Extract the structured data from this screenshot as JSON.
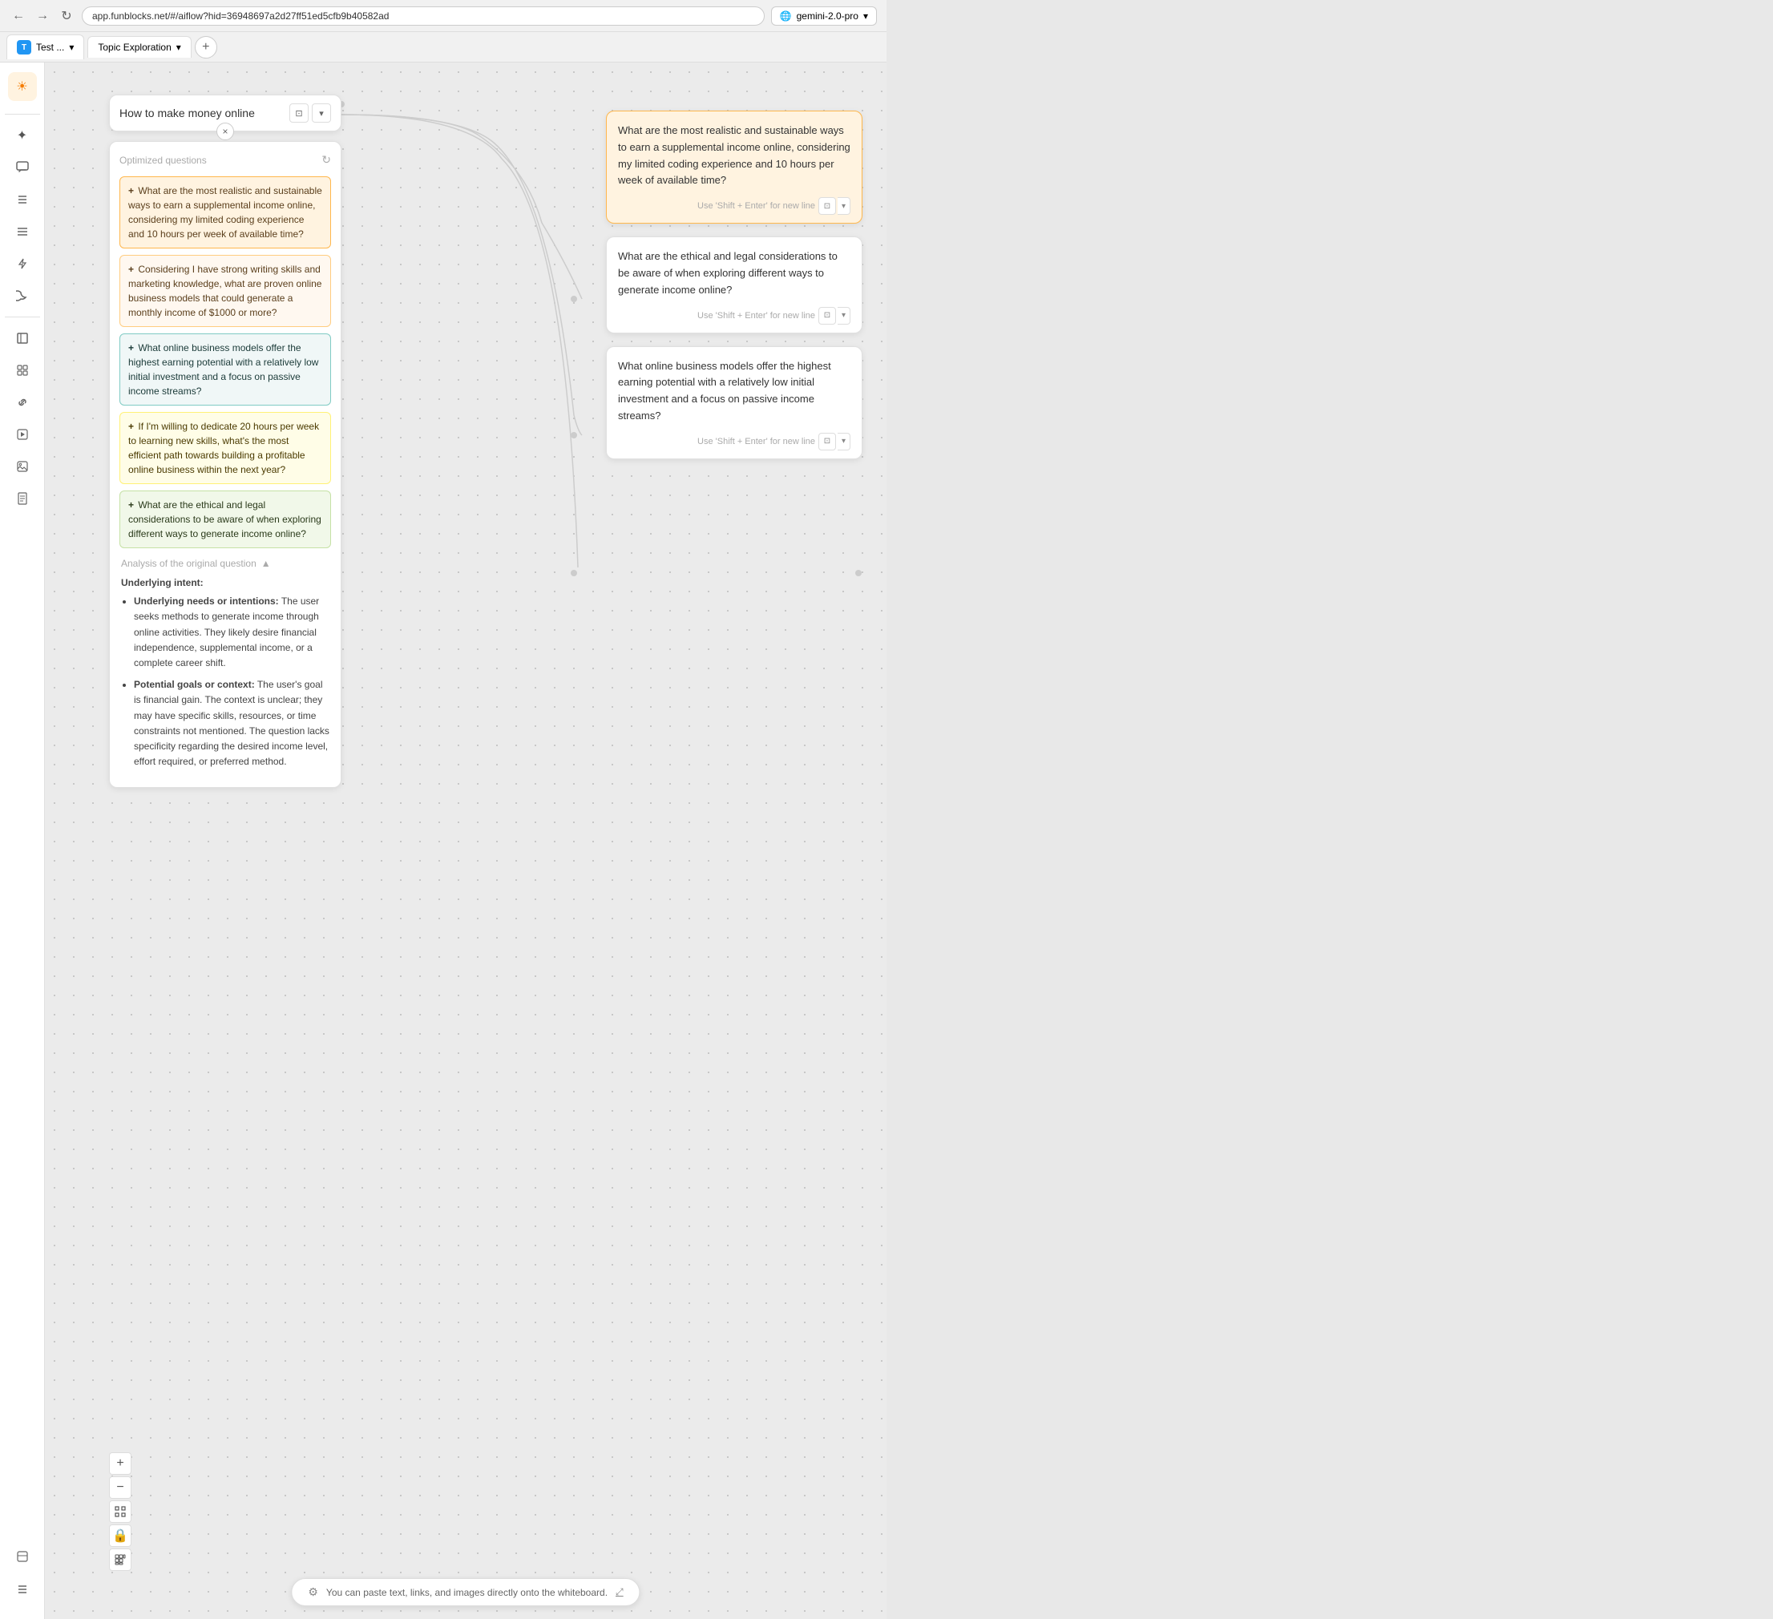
{
  "browser": {
    "url": "app.funblocks.net/#/aiflow?hid=36948697a2d27ff51ed5cfb9b40582ad",
    "back_icon": "←",
    "forward_icon": "→",
    "reload_icon": "↻",
    "model_icon": "🌐",
    "model_label": "gemini-2.0-pro",
    "model_dropdown": "▾"
  },
  "tabs": [
    {
      "id": "test",
      "avatar": "T",
      "label": "Test ...",
      "dropdown": "▾"
    },
    {
      "id": "topic",
      "label": "Topic Exploration",
      "dropdown": "▾"
    }
  ],
  "tab_new_label": "+",
  "sidebar": {
    "top_icon": "☀",
    "icons": [
      {
        "id": "star",
        "symbol": "✦",
        "active": false
      },
      {
        "id": "chat",
        "symbol": "💬",
        "active": false
      },
      {
        "id": "list",
        "symbol": "≡",
        "active": false
      },
      {
        "id": "menu",
        "symbol": "☰",
        "active": false
      },
      {
        "id": "code",
        "symbol": "⚡",
        "active": false
      },
      {
        "id": "moon",
        "symbol": "☽",
        "active": false
      }
    ],
    "bottom_icons": [
      {
        "id": "book",
        "symbol": "📖"
      },
      {
        "id": "layers",
        "symbol": "▦"
      },
      {
        "id": "link",
        "symbol": "🔗"
      },
      {
        "id": "play",
        "symbol": "▶"
      },
      {
        "id": "image",
        "symbol": "🖼"
      },
      {
        "id": "doc",
        "symbol": "📄"
      }
    ],
    "zoom_icons": [
      {
        "id": "panel",
        "symbol": "⬜"
      },
      {
        "id": "items",
        "symbol": "≡"
      }
    ]
  },
  "topic_input": {
    "text": "How to make money online",
    "icon1": "⊡",
    "icon2": "▾",
    "close": "×"
  },
  "questions_card": {
    "title": "Optimized questions",
    "refresh_icon": "↻",
    "items": [
      {
        "id": "q1",
        "style": "orange",
        "prefix": "+",
        "text": "What are the most realistic and sustainable ways to earn a supplemental income online, considering my limited coding experience and 10 hours per week of available time?"
      },
      {
        "id": "q2",
        "style": "orange-2",
        "prefix": "+",
        "text": "Considering I have strong writing skills and marketing knowledge, what are proven online business models that could generate a monthly income of $1000 or more?"
      },
      {
        "id": "q3",
        "style": "teal",
        "prefix": "+",
        "text": "What online business models offer the highest earning potential with a relatively low initial investment and a focus on passive income streams?"
      },
      {
        "id": "q4",
        "style": "yellow",
        "prefix": "+",
        "text": "If I'm willing to dedicate 20 hours per week to learning new skills, what's the most efficient path towards building a profitable online business within the next year?"
      },
      {
        "id": "q5",
        "style": "green",
        "prefix": "+",
        "text": "What are the ethical and legal considerations to be aware of when exploring different ways to generate income online?"
      }
    ]
  },
  "analysis": {
    "header": "Analysis of the original question",
    "toggle_icon": "▲",
    "label": "Underlying intent:",
    "items": [
      {
        "bold": "Underlying needs or intentions:",
        "text": " The user seeks methods to generate income through online activities. They likely desire financial independence, supplemental income, or a complete career shift."
      },
      {
        "bold": "Potential goals or context:",
        "text": " The user's goal is financial gain. The context is unclear; they may have specific skills, resources, or time constraints not mentioned. The question lacks specificity regarding the desired income level, effort required, or preferred method."
      }
    ]
  },
  "output_cards": [
    {
      "id": "oc1",
      "style": "orange",
      "text": "What are the most realistic and sustainable ways to earn a supplemental income online, considering my limited coding experience and 10 hours per week of available time?",
      "hint": "Use 'Shift + Enter' for new line",
      "action_icon": "⊡",
      "dropdown_icon": "▾"
    },
    {
      "id": "oc2",
      "style": "default",
      "text": "What are the ethical and legal considerations to be aware of when exploring different ways to generate income online?",
      "hint": "Use 'Shift + Enter' for new line",
      "action_icon": "⊡",
      "dropdown_icon": "▾"
    },
    {
      "id": "oc3",
      "style": "default",
      "text": "What online business models offer the highest earning potential with a relatively low initial investment and a focus on passive income streams?",
      "hint": "Use 'Shift + Enter' for new line",
      "action_icon": "⊡",
      "dropdown_icon": "▾"
    }
  ],
  "bottom_bar": {
    "icon": "⚙",
    "text": "You can paste text, links, and images directly onto the whiteboard.",
    "link_icon": "⤢"
  },
  "zoom": {
    "plus": "+",
    "minus": "−",
    "fit": "⊡",
    "lock": "🔒",
    "grid": "▦"
  }
}
